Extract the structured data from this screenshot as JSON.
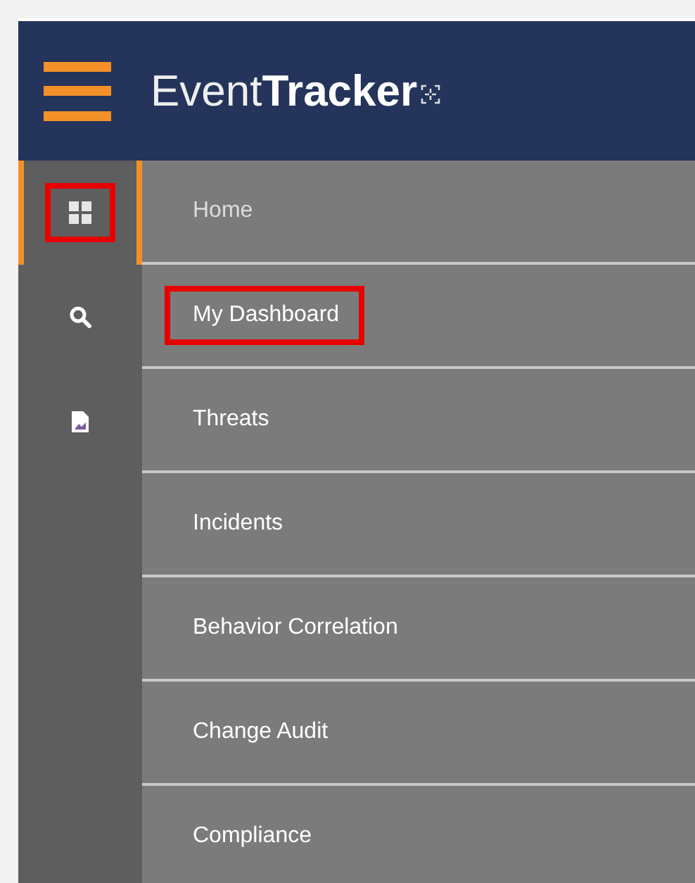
{
  "header": {
    "logo_light": "Event",
    "logo_bold": "Tracker"
  },
  "rail": [
    {
      "kind": "grid",
      "selected": true,
      "highlighted": true
    },
    {
      "kind": "search",
      "selected": false,
      "highlighted": false
    },
    {
      "kind": "report",
      "selected": false,
      "highlighted": false
    }
  ],
  "menu": [
    {
      "label": "Home",
      "selected": true,
      "highlighted": false
    },
    {
      "label": "My Dashboard",
      "selected": false,
      "highlighted": true
    },
    {
      "label": "Threats",
      "selected": false,
      "highlighted": false
    },
    {
      "label": "Incidents",
      "selected": false,
      "highlighted": false
    },
    {
      "label": "Behavior Correlation",
      "selected": false,
      "highlighted": false
    },
    {
      "label": "Change Audit",
      "selected": false,
      "highlighted": false
    },
    {
      "label": "Compliance",
      "selected": false,
      "highlighted": false
    }
  ]
}
